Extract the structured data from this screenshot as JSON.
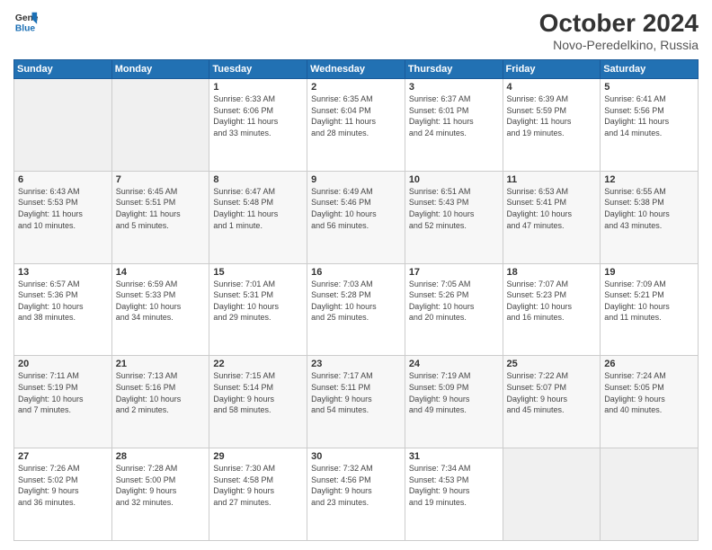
{
  "header": {
    "logo_line1": "General",
    "logo_line2": "Blue",
    "main_title": "October 2024",
    "subtitle": "Novo-Peredelkino, Russia"
  },
  "days_of_week": [
    "Sunday",
    "Monday",
    "Tuesday",
    "Wednesday",
    "Thursday",
    "Friday",
    "Saturday"
  ],
  "weeks": [
    [
      {
        "day": "",
        "data": ""
      },
      {
        "day": "",
        "data": ""
      },
      {
        "day": "1",
        "data": "Sunrise: 6:33 AM\nSunset: 6:06 PM\nDaylight: 11 hours\nand 33 minutes."
      },
      {
        "day": "2",
        "data": "Sunrise: 6:35 AM\nSunset: 6:04 PM\nDaylight: 11 hours\nand 28 minutes."
      },
      {
        "day": "3",
        "data": "Sunrise: 6:37 AM\nSunset: 6:01 PM\nDaylight: 11 hours\nand 24 minutes."
      },
      {
        "day": "4",
        "data": "Sunrise: 6:39 AM\nSunset: 5:59 PM\nDaylight: 11 hours\nand 19 minutes."
      },
      {
        "day": "5",
        "data": "Sunrise: 6:41 AM\nSunset: 5:56 PM\nDaylight: 11 hours\nand 14 minutes."
      }
    ],
    [
      {
        "day": "6",
        "data": "Sunrise: 6:43 AM\nSunset: 5:53 PM\nDaylight: 11 hours\nand 10 minutes."
      },
      {
        "day": "7",
        "data": "Sunrise: 6:45 AM\nSunset: 5:51 PM\nDaylight: 11 hours\nand 5 minutes."
      },
      {
        "day": "8",
        "data": "Sunrise: 6:47 AM\nSunset: 5:48 PM\nDaylight: 11 hours\nand 1 minute."
      },
      {
        "day": "9",
        "data": "Sunrise: 6:49 AM\nSunset: 5:46 PM\nDaylight: 10 hours\nand 56 minutes."
      },
      {
        "day": "10",
        "data": "Sunrise: 6:51 AM\nSunset: 5:43 PM\nDaylight: 10 hours\nand 52 minutes."
      },
      {
        "day": "11",
        "data": "Sunrise: 6:53 AM\nSunset: 5:41 PM\nDaylight: 10 hours\nand 47 minutes."
      },
      {
        "day": "12",
        "data": "Sunrise: 6:55 AM\nSunset: 5:38 PM\nDaylight: 10 hours\nand 43 minutes."
      }
    ],
    [
      {
        "day": "13",
        "data": "Sunrise: 6:57 AM\nSunset: 5:36 PM\nDaylight: 10 hours\nand 38 minutes."
      },
      {
        "day": "14",
        "data": "Sunrise: 6:59 AM\nSunset: 5:33 PM\nDaylight: 10 hours\nand 34 minutes."
      },
      {
        "day": "15",
        "data": "Sunrise: 7:01 AM\nSunset: 5:31 PM\nDaylight: 10 hours\nand 29 minutes."
      },
      {
        "day": "16",
        "data": "Sunrise: 7:03 AM\nSunset: 5:28 PM\nDaylight: 10 hours\nand 25 minutes."
      },
      {
        "day": "17",
        "data": "Sunrise: 7:05 AM\nSunset: 5:26 PM\nDaylight: 10 hours\nand 20 minutes."
      },
      {
        "day": "18",
        "data": "Sunrise: 7:07 AM\nSunset: 5:23 PM\nDaylight: 10 hours\nand 16 minutes."
      },
      {
        "day": "19",
        "data": "Sunrise: 7:09 AM\nSunset: 5:21 PM\nDaylight: 10 hours\nand 11 minutes."
      }
    ],
    [
      {
        "day": "20",
        "data": "Sunrise: 7:11 AM\nSunset: 5:19 PM\nDaylight: 10 hours\nand 7 minutes."
      },
      {
        "day": "21",
        "data": "Sunrise: 7:13 AM\nSunset: 5:16 PM\nDaylight: 10 hours\nand 2 minutes."
      },
      {
        "day": "22",
        "data": "Sunrise: 7:15 AM\nSunset: 5:14 PM\nDaylight: 9 hours\nand 58 minutes."
      },
      {
        "day": "23",
        "data": "Sunrise: 7:17 AM\nSunset: 5:11 PM\nDaylight: 9 hours\nand 54 minutes."
      },
      {
        "day": "24",
        "data": "Sunrise: 7:19 AM\nSunset: 5:09 PM\nDaylight: 9 hours\nand 49 minutes."
      },
      {
        "day": "25",
        "data": "Sunrise: 7:22 AM\nSunset: 5:07 PM\nDaylight: 9 hours\nand 45 minutes."
      },
      {
        "day": "26",
        "data": "Sunrise: 7:24 AM\nSunset: 5:05 PM\nDaylight: 9 hours\nand 40 minutes."
      }
    ],
    [
      {
        "day": "27",
        "data": "Sunrise: 7:26 AM\nSunset: 5:02 PM\nDaylight: 9 hours\nand 36 minutes."
      },
      {
        "day": "28",
        "data": "Sunrise: 7:28 AM\nSunset: 5:00 PM\nDaylight: 9 hours\nand 32 minutes."
      },
      {
        "day": "29",
        "data": "Sunrise: 7:30 AM\nSunset: 4:58 PM\nDaylight: 9 hours\nand 27 minutes."
      },
      {
        "day": "30",
        "data": "Sunrise: 7:32 AM\nSunset: 4:56 PM\nDaylight: 9 hours\nand 23 minutes."
      },
      {
        "day": "31",
        "data": "Sunrise: 7:34 AM\nSunset: 4:53 PM\nDaylight: 9 hours\nand 19 minutes."
      },
      {
        "day": "",
        "data": ""
      },
      {
        "day": "",
        "data": ""
      }
    ]
  ]
}
